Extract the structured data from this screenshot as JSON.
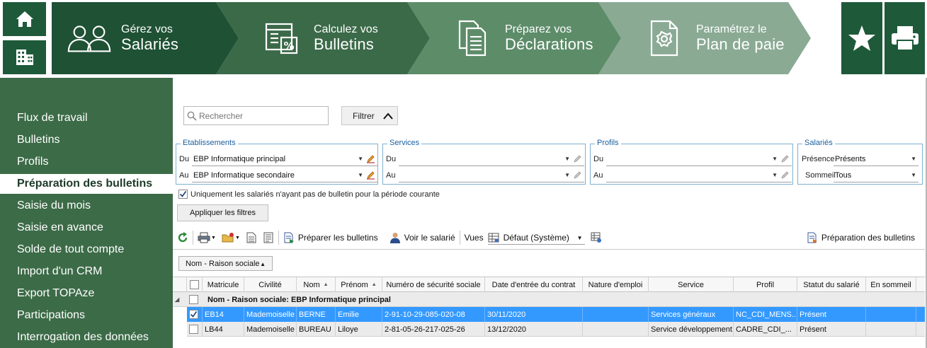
{
  "colors": {
    "dark_green": "#1e5a3a",
    "step1": "#1f5134",
    "step2": "#3b6a49",
    "step3": "#5d8c69",
    "step4": "#8aaa94",
    "nav_bg": "#3c6b47",
    "selection": "#3399ff"
  },
  "top_icons": {
    "home": "home-icon",
    "establishment": "building-icon",
    "favorites": "star-icon",
    "print": "printer-icon"
  },
  "steps": [
    {
      "line1": "Gérez vos",
      "line2": "Salariés",
      "icon": "users-icon"
    },
    {
      "line1": "Calculez vos",
      "line2": "Bulletins",
      "icon": "calculator-icon"
    },
    {
      "line1": "Préparez vos",
      "line2": "Déclarations",
      "icon": "documents-icon"
    },
    {
      "line1": "Paramétrez le",
      "line2": "Plan de paie",
      "icon": "settings-document-icon"
    }
  ],
  "nav": {
    "items": [
      "Flux de travail",
      "Bulletins",
      "Profils",
      "Préparation des bulletins",
      "Saisie du mois",
      "Saisie en avance",
      "Solde de tout compte",
      "Import d'un CRM",
      "Export TOPAze",
      "Participations",
      "Interrogation des données"
    ],
    "active_index": 3
  },
  "search": {
    "placeholder": "Rechercher"
  },
  "filter_button": "Filtrer",
  "filters": {
    "etablissements": {
      "legend": "Etablissements",
      "du_label": "Du",
      "du_value": "EBP Informatique principal",
      "au_label": "Au",
      "au_value": "EBP Informatique secondaire"
    },
    "services": {
      "legend": "Services",
      "du_label": "Du",
      "du_value": "",
      "au_label": "Au",
      "au_value": ""
    },
    "profils": {
      "legend": "Profils",
      "du_label": "Du",
      "du_value": "",
      "au_label": "Au",
      "au_value": ""
    },
    "salaries": {
      "legend": "Salariés",
      "presence_label": "Présence",
      "presence_value": "Présents",
      "sommeil_label": "Sommeil",
      "sommeil_value": "Tous"
    }
  },
  "only_without_payslip": {
    "label": "Uniquement les salariés n'ayant pas de bulletin pour la période courante",
    "checked": true
  },
  "apply_filters": "Appliquer les filtres",
  "toolbar": {
    "prepare": "Préparer les bulletins",
    "view_employee": "Voir le salarié",
    "views_label": "Vues",
    "views_value": "Défaut (Système)",
    "right_action": "Préparation des bulletins"
  },
  "group_by": "Nom - Raison sociale",
  "table": {
    "columns": [
      "Matricule",
      "Civilité",
      "Nom",
      "Prénom",
      "Numéro de sécurité sociale",
      "Date d'entrée du contrat",
      "Nature d'emploi",
      "Service",
      "Profil",
      "Statut du salarié",
      "En sommeil"
    ],
    "group_label": "Nom - Raison sociale: EBP Informatique principal",
    "rows": [
      {
        "checked": true,
        "cells": [
          "EB14",
          "Mademoiselle",
          "BERNE",
          "Emilie",
          "2-91-10-29-085-020-08",
          "30/11/2020",
          "",
          "Services généraux",
          "NC_CDI_MENS...",
          "Présent",
          ""
        ]
      },
      {
        "checked": false,
        "cells": [
          "LB44",
          "Mademoiselle",
          "BUREAU",
          "Liloye",
          "2-81-05-26-217-025-26",
          "13/12/2020",
          "",
          "Service développement",
          "CADRE_CDI_...",
          "Présent",
          ""
        ]
      }
    ]
  }
}
